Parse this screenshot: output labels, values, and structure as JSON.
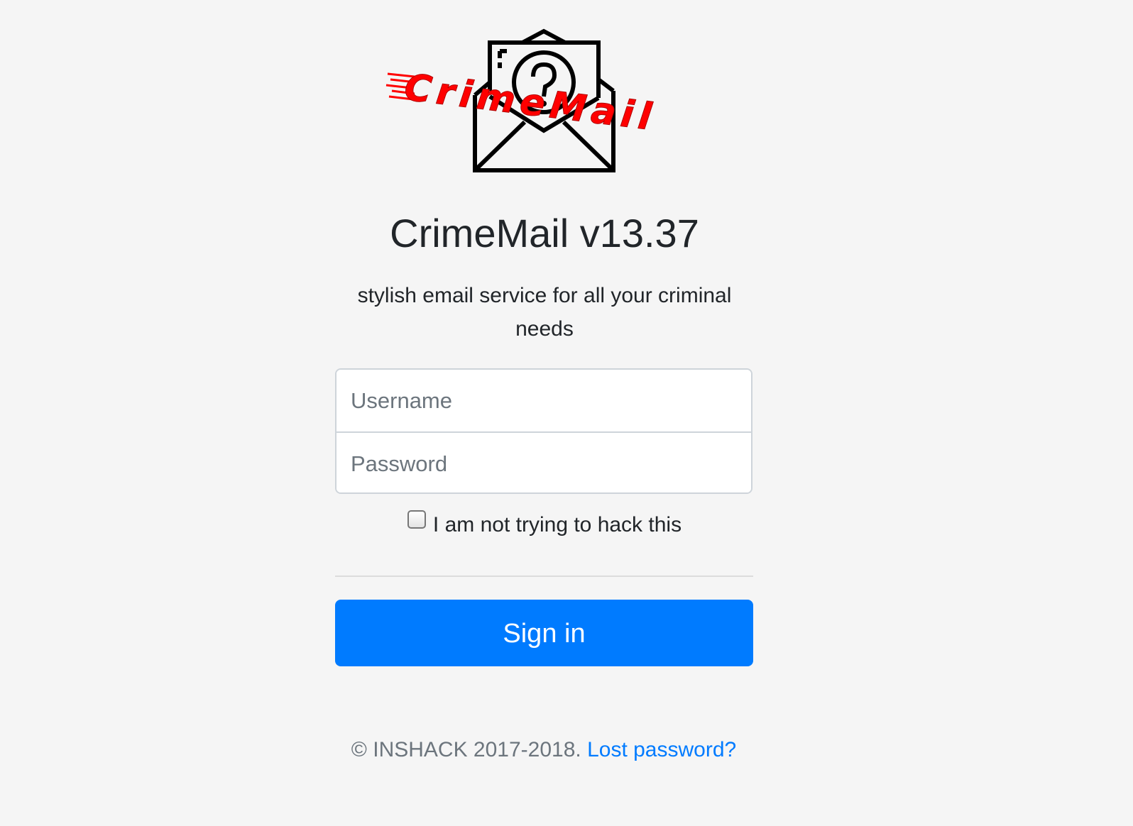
{
  "logo": {
    "icon": "envelope-question-icon",
    "wordmark": "CrimeMail",
    "wordmark_color": "#ff0000"
  },
  "header": {
    "title": "CrimeMail v13.37",
    "tagline": "stylish email service for all your criminal needs"
  },
  "form": {
    "username_placeholder": "Username",
    "password_placeholder": "Password",
    "checkbox_label": "I am not trying to hack this",
    "checkbox_checked": false,
    "submit_label": "Sign in"
  },
  "footer": {
    "copyright": "© INSHACK 2017-2018.",
    "lost_password_link": "Lost password?"
  },
  "colors": {
    "accent": "#007bff",
    "background": "#f5f5f5",
    "text": "#212529",
    "muted": "#6c757d"
  }
}
